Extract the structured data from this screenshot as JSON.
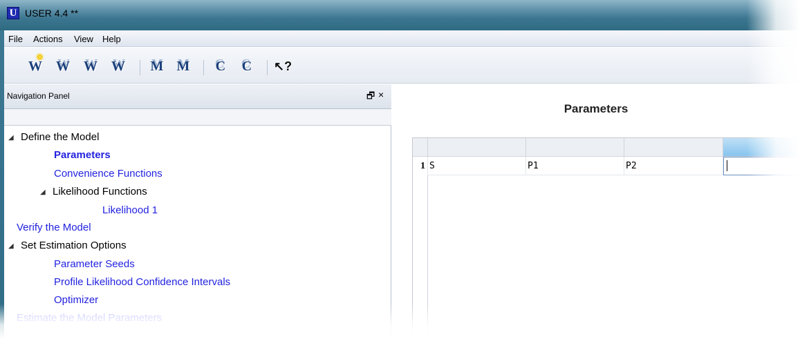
{
  "window": {
    "title": "USER 4.4 **",
    "icon_letter": "U"
  },
  "menu": [
    "File",
    "Actions",
    "View",
    "Help"
  ],
  "toolbar": {
    "buttons": [
      {
        "name": "new-workspace",
        "glyph": "W",
        "icon": "new-workspace-icon"
      },
      {
        "name": "open-workspace",
        "glyph": "W",
        "icon": "open-workspace-icon"
      },
      {
        "name": "save-workspace",
        "glyph": "W",
        "icon": "save-workspace-icon"
      },
      {
        "name": "save-workspace-as",
        "glyph": "W",
        "icon": "save-workspace-as-icon"
      },
      {
        "name": "open-model",
        "glyph": "M",
        "icon": "open-model-icon"
      },
      {
        "name": "save-model",
        "glyph": "M",
        "icon": "save-model-icon"
      },
      {
        "name": "open-c",
        "glyph": "C",
        "icon": "open-c-icon"
      },
      {
        "name": "save-c",
        "glyph": "C",
        "icon": "save-c-icon"
      },
      {
        "name": "help-pointer",
        "glyph": "↖?",
        "icon": "context-help-icon"
      }
    ]
  },
  "nav": {
    "title": "Navigation Panel",
    "float_glyph": "🗗",
    "close_glyph": "×",
    "items": [
      {
        "label": "Define the Model",
        "kind": "group",
        "expanded": true
      },
      {
        "label": "Parameters",
        "kind": "selected"
      },
      {
        "label": "Convenience Functions",
        "kind": "link"
      },
      {
        "label": "Likelihood Functions",
        "kind": "group",
        "expanded": true
      },
      {
        "label": "Likelihood 1",
        "kind": "link"
      },
      {
        "label": "Verify the Model",
        "kind": "link"
      },
      {
        "label": "Set Estimation Options",
        "kind": "group",
        "expanded": true
      },
      {
        "label": "Parameter Seeds",
        "kind": "link"
      },
      {
        "label": "Profile Likelihood Confidence Intervals",
        "kind": "link"
      },
      {
        "label": "Optimizer",
        "kind": "link"
      },
      {
        "label": "Estimate the Model Parameters",
        "kind": "link"
      }
    ]
  },
  "main": {
    "title": "Parameters",
    "grid": {
      "rows": [
        {
          "row_label": "1",
          "cells": [
            "S",
            "P1",
            "P2",
            ""
          ]
        }
      ]
    }
  }
}
